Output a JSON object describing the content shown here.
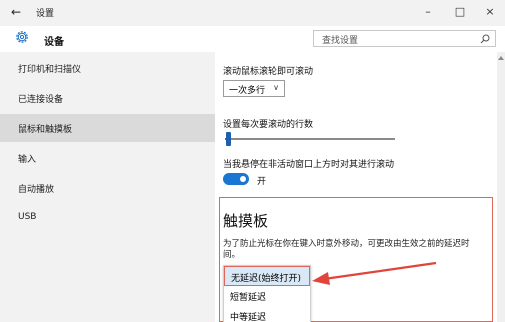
{
  "window": {
    "title": "设置",
    "back_label": "←",
    "minimize_label": "–",
    "maximize_label": "□",
    "close_label": "×"
  },
  "header": {
    "page_title": "设备",
    "search_placeholder": "查找设置"
  },
  "sidebar": {
    "items": [
      {
        "label": "打印机和扫描仪"
      },
      {
        "label": "已连接设备"
      },
      {
        "label": "鼠标和触摸板"
      },
      {
        "label": "输入"
      },
      {
        "label": "自动播放"
      },
      {
        "label": "USB"
      }
    ],
    "active_index": 2
  },
  "main": {
    "scroll_label": "滚动鼠标滚轮即可滚动",
    "scroll_value": "一次多行",
    "lines_label": "设置每次要滚动的行数",
    "lines_slider_fraction": 0.02,
    "inactive_scroll_label": "当我悬停在非活动窗口上方时对其进行滚动",
    "toggle_state_label": "开",
    "touchpad_heading": "触摸板",
    "touchpad_desc": "为了防止光标在你在键入时意外移动，可更改由生效之前的延迟时间。",
    "delay_options": [
      "无延迟(始终打开)",
      "短暂延迟",
      "中等延迟"
    ],
    "selected_option": 0
  },
  "colors": {
    "accent": "#1976d2",
    "highlight": "#e0665a",
    "selection_bg": "#d8e8f6"
  },
  "icons": {
    "gear": "gear-icon",
    "search": "search-icon",
    "back": "back-arrow-icon"
  }
}
